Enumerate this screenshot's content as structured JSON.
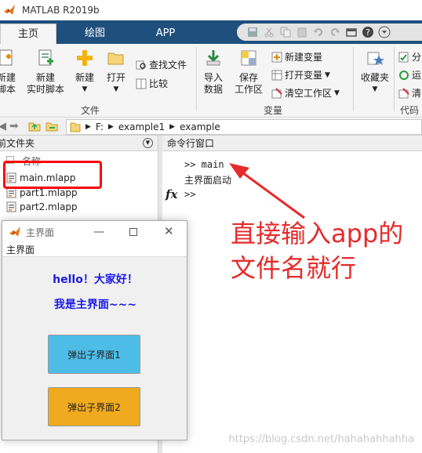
{
  "window": {
    "title": "MATLAB R2019b"
  },
  "tabs": [
    {
      "label": "主页",
      "active": true
    },
    {
      "label": "绘图",
      "active": false
    },
    {
      "label": "APP",
      "active": false
    }
  ],
  "quick_access": [
    "save-icon",
    "cut-icon",
    "copy-icon",
    "paste-icon",
    "undo-icon",
    "redo-icon",
    "switch-windows-icon",
    "help-icon",
    "options-icon"
  ],
  "ribbon": {
    "new_script": "新建\n脚本",
    "new_live_script": "新建\n实时脚本",
    "new": "新建",
    "open": "打开",
    "find_files": "查找文件",
    "compare": "比较",
    "import_data": "导入\n数据",
    "save_workspace": "保存\n工作区",
    "new_variable": "新建变量",
    "open_variable": "打开变量",
    "clear_workspace": "清空工作区",
    "favorites": "收藏夹",
    "analyze": "分",
    "run": "运",
    "clear": "清",
    "group_file": "文件",
    "group_variable": "变量",
    "group_code": "代码"
  },
  "address": {
    "segments": [
      "F:",
      "example1",
      "example"
    ]
  },
  "file_panel": {
    "title": "前文件夹",
    "column": "名称",
    "files": [
      "main.mlapp",
      "part1.mlapp",
      "part2.mlapp"
    ]
  },
  "command_window": {
    "title": "命令行窗口",
    "lines": [
      ">> main",
      "主界面启动"
    ],
    "prompt": ">>",
    "fx": "fx"
  },
  "annotation": {
    "line1": "直接输入app的",
    "line2": "文件名就行"
  },
  "app_window": {
    "title": "主界面",
    "menu": "主界面",
    "heading1": "hello！大家好！",
    "heading2": "我是主界面~~~",
    "button1": "弹出子界面1",
    "button2": "弹出子界面2",
    "button1_color": "#4dbde8",
    "button2_color": "#f0aa1e",
    "heading_color": "#1a1ae6"
  },
  "watermark": "https://blog.csdn.net/hahahahhahha"
}
